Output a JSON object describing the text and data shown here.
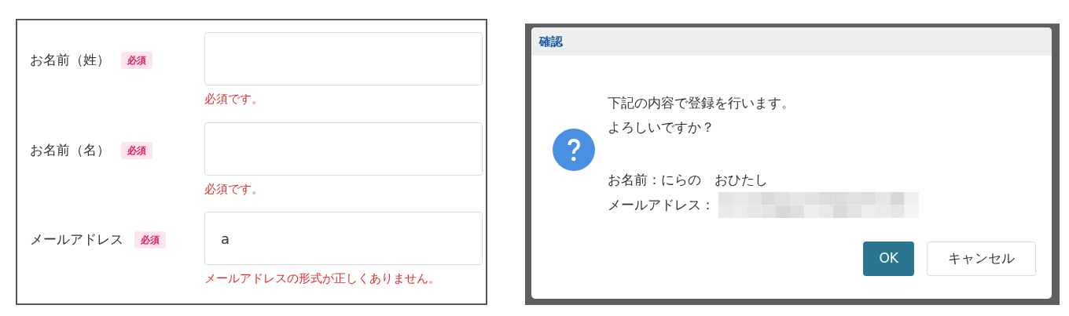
{
  "form": {
    "fields": [
      {
        "label": "お名前（姓）",
        "badge": "必須",
        "error": "必須です。"
      },
      {
        "label": "お名前（名）",
        "badge": "必須",
        "error": "必須です。"
      },
      {
        "label": "メールアドレス",
        "badge": "必須",
        "value": "a",
        "error": "メールアドレスの形式が正しくありません。"
      }
    ]
  },
  "dialog": {
    "title": "確認",
    "message": [
      "下記の内容で登録を行います。",
      "よろしいですか？"
    ],
    "name_line": "お名前：にらの　おひたし",
    "email_label": "メールアドレス：",
    "email_redacted": true,
    "buttons": [
      {
        "label": "OK",
        "kind": "primary"
      },
      {
        "label": "キャンセル",
        "kind": "secondary"
      }
    ]
  }
}
